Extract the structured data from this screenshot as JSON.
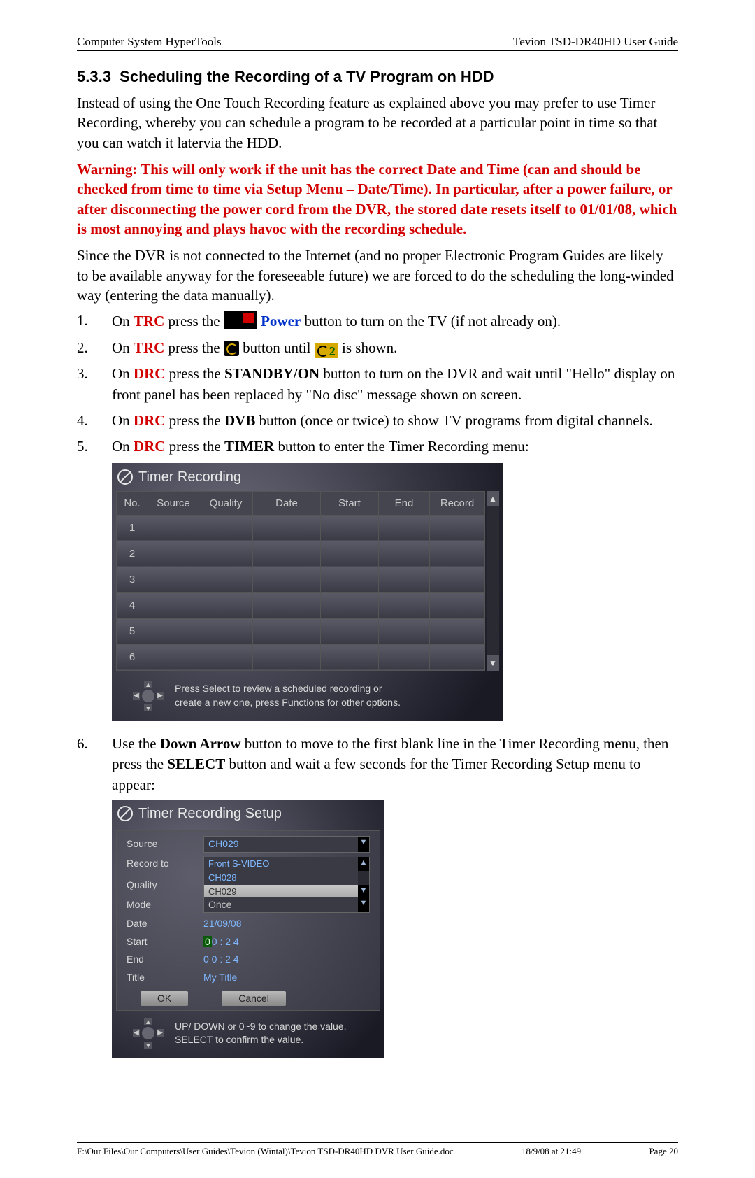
{
  "header": {
    "left": "Computer System HyperTools",
    "right": "Tevion TSD-DR40HD User Guide"
  },
  "section_number": "5.3.3",
  "section_title": "Scheduling the Recording of a TV Program on HDD",
  "intro": "Instead of using the One Touch Recording feature as explained above you may prefer to use Timer Recording, whereby you can schedule a program to be recorded at a particular point in time so that you can watch it latervia the HDD.",
  "warning": "Warning: This will only work if the unit has the correct Date and Time (can and should be checked from time to time via Setup Menu – Date/Time). In particular, after a power failure, or after disconnecting the power cord from the DVR, the stored date resets itself to 01/01/08, which is most annoying and plays havoc with the recording schedule.",
  "para2": "Since the DVR is not connected to the Internet (and no proper Electronic Program Guides are likely to be available anyway for the foreseeable future) we are forced to do the scheduling the long-winded way (entering the data manually).",
  "steps": {
    "s1": {
      "num": "1.",
      "pre": "On ",
      "trc": "TRC",
      "mid": " press the ",
      "power": "Power",
      "post": " button to turn on the TV (if not already on)."
    },
    "s2": {
      "num": "2.",
      "pre": "On ",
      "trc": "TRC",
      "mid": " press the ",
      "btw": " button until ",
      "post": " is shown."
    },
    "s3": {
      "num": "3.",
      "pre": "On ",
      "drc": "DRC",
      "mid": " press the ",
      "standby": "STANDBY/ON",
      "post": " button to turn on the DVR and wait until \"Hello\" display on front panel has been replaced by \"No disc\" message shown on screen."
    },
    "s4": {
      "num": "4.",
      "pre": "On ",
      "drc": "DRC",
      "mid": " press the ",
      "dvb": "DVB",
      "post": " button (once or twice) to show TV programs from digital channels."
    },
    "s5": {
      "num": "5.",
      "pre": "On ",
      "drc": "DRC",
      "mid": " press the ",
      "timer": "TIMER",
      "post": " button to enter the Timer Recording menu:"
    },
    "s6": {
      "num": "6.",
      "pre": "Use the ",
      "down": "Down Arrow",
      "mid": " button to move to the first blank line in the Timer Recording menu, then press the ",
      "select": "SELECT",
      "post": " button and wait a few seconds for the Timer Recording Setup menu to appear:"
    }
  },
  "timer_panel": {
    "title": "Timer Recording",
    "cols": {
      "no": "No.",
      "source": "Source",
      "quality": "Quality",
      "date": "Date",
      "start": "Start",
      "end": "End",
      "record": "Record"
    },
    "rows": [
      "1",
      "2",
      "3",
      "4",
      "5",
      "6"
    ],
    "hint1": "Press Select to review a scheduled recording or",
    "hint2": "create a new one, press Functions for other options."
  },
  "setup_panel": {
    "title": "Timer Recording Setup",
    "source_label": "Source",
    "source_value": "CH029",
    "record_to_label": "Record to",
    "dd_items": {
      "a": "Front S-VIDEO",
      "b": "CH028",
      "c": "CH029"
    },
    "quality_label": "Quality",
    "mode_label": "Mode",
    "mode_value": "Once",
    "date_label": "Date",
    "date_value": "21/09/08",
    "start_label": "Start",
    "start_d0": "0",
    "start_rest": "0 : 2 4",
    "end_label": "End",
    "end_value": "0 0 : 2 4",
    "title_label": "Title",
    "title_value": "My Title",
    "ok": "OK",
    "cancel": "Cancel",
    "hint1": "UP/ DOWN or 0~9 to change the value,",
    "hint2": "SELECT to confirm the value."
  },
  "footer": {
    "path": "F:\\Our Files\\Our Computers\\User Guides\\Tevion (Wintal)\\Tevion TSD-DR40HD DVR User Guide.doc",
    "date": "18/9/08 at 21:49",
    "page": "Page 20"
  }
}
